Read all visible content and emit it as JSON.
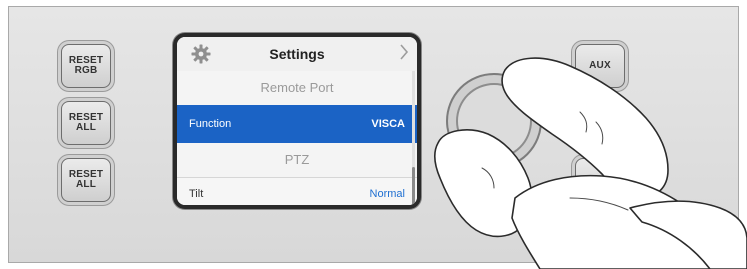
{
  "left_buttons": [
    {
      "label": "RESET\nRGB"
    },
    {
      "label": "RESET\nALL"
    },
    {
      "label": "RESET\nALL"
    }
  ],
  "right_buttons": [
    {
      "label": "AUX"
    }
  ],
  "screen": {
    "header": {
      "title": "Settings",
      "icon": "gear-icon",
      "nav_icon": "chevron-right-icon"
    },
    "rows": [
      {
        "type": "section",
        "label": "Remote Port"
      },
      {
        "type": "setting",
        "label": "Function",
        "value": "VISCA",
        "selected": true
      },
      {
        "type": "section",
        "label": "PTZ"
      },
      {
        "type": "setting",
        "label": "Tilt",
        "value": "Normal",
        "selected": false
      }
    ]
  },
  "colors": {
    "selection": "#1b63c5",
    "value_text": "#1f6fd1"
  }
}
